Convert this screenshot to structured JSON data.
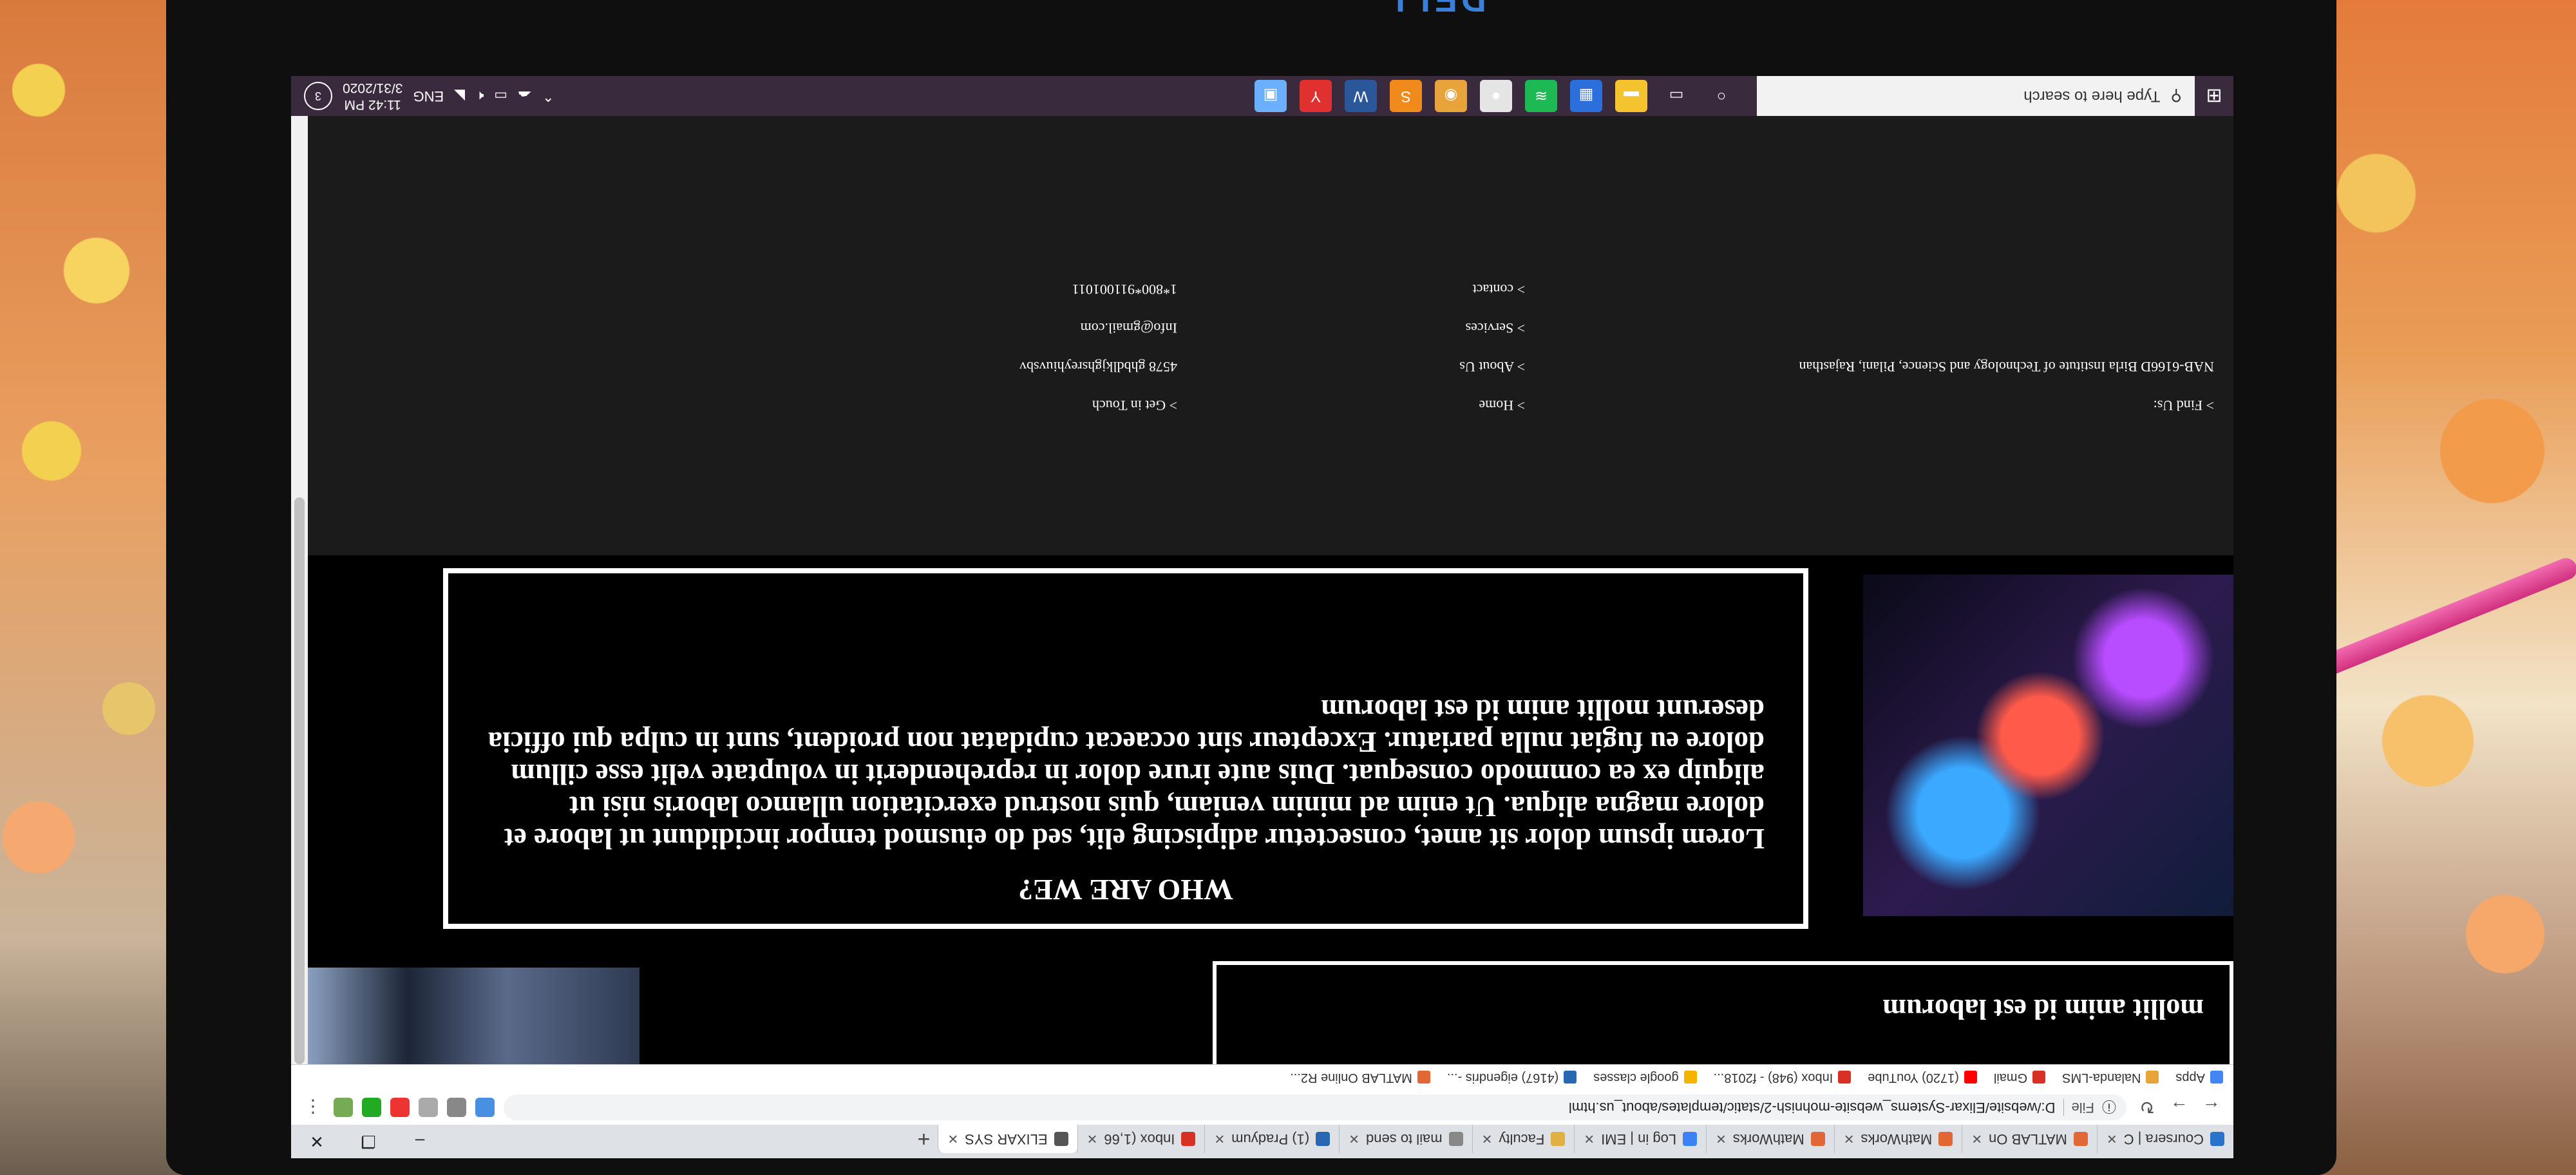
{
  "browser": {
    "tabs": [
      {
        "label": "Coursera | C",
        "color": "#2a73cc"
      },
      {
        "label": "MATLAB On",
        "color": "#e16737"
      },
      {
        "label": "MathWorks",
        "color": "#e16737"
      },
      {
        "label": "MathWorks",
        "color": "#e16737"
      },
      {
        "label": "Log in | EMI",
        "color": "#3b82f6"
      },
      {
        "label": "Faculty",
        "color": "#e0b040"
      },
      {
        "label": "mail to send",
        "color": "#888888"
      },
      {
        "label": "(1) Pradyum",
        "color": "#2867b2"
      },
      {
        "label": "Inbox (1,66",
        "color": "#d93025"
      },
      {
        "label": "ELIXAR SYS",
        "color": "#555555"
      }
    ],
    "active_tab_index": 9,
    "url_scheme": "File",
    "url": "D:/website/Elixar-Systems_website-mohnish-2/static/templates/about_us.html",
    "bookmarks": [
      {
        "label": "Apps",
        "color": "#4285f4"
      },
      {
        "label": "Nalanda-LMS",
        "color": "#e8a33a"
      },
      {
        "label": "Gmail",
        "color": "#d93025"
      },
      {
        "label": "(1720) YouTube",
        "color": "#ff0000"
      },
      {
        "label": "Inbox (948) - f2018...",
        "color": "#d93025"
      },
      {
        "label": "google classes",
        "color": "#f4b400"
      },
      {
        "label": "(4167) eigendris -...",
        "color": "#2867b2"
      },
      {
        "label": "MATLAB Online R2...",
        "color": "#e16737"
      }
    ]
  },
  "page": {
    "top_text": "mollit anim id est laborum",
    "about_title": "WHO ARE WE?",
    "about_text": "Lorem ipsum dolor sit amet, consectetur adipiscing elit, sed do eiusmod tempor incididunt ut labore et dolore magna aliqua. Ut enim ad minim veniam, quis nostrud exercitation ullamco laboris nisi ut aliquip ex ea commodo consequat. Duis aute irure dolor in reprehenderit in voluptate velit esse cillum dolore eu fugiat nulla pariatur. Excepteur sint occaecat cupidatat non proident, sunt in culpa qui officia deserunt mollit anim id est laborum",
    "footer": {
      "find_us_label": "> Find Us:",
      "address": "NAB-6166D Birla Institute of Technology and Science, Pilani, Rajasthan",
      "links": [
        "> Home",
        "> About Us",
        "> Services",
        "> contact"
      ],
      "get_in_touch_label": "> Get in Touch",
      "contact_lines": [
        "4578 ghbdlkjghsreyhiuvsbv",
        "Info@gmail.com",
        "1*800*911001011"
      ]
    }
  },
  "taskbar": {
    "search_placeholder": "Type here to search",
    "apps": [
      {
        "name": "cortana-icon",
        "color": "#3a2a3e",
        "glyph": "○"
      },
      {
        "name": "task-view-icon",
        "color": "#3a2a3e",
        "glyph": "▭"
      },
      {
        "name": "file-explorer-icon",
        "color": "#f4c430",
        "glyph": "▬"
      },
      {
        "name": "store-icon",
        "color": "#2a6fdb",
        "glyph": "▦"
      },
      {
        "name": "spotify-icon",
        "color": "#1db954",
        "glyph": "≋"
      },
      {
        "name": "app-icon",
        "color": "#e5e5e5",
        "glyph": "●"
      },
      {
        "name": "chrome-icon",
        "color": "#e8a33a",
        "glyph": "◉"
      },
      {
        "name": "sublime-icon",
        "color": "#f08a1c",
        "glyph": "S"
      },
      {
        "name": "word-icon",
        "color": "#2b579a",
        "glyph": "W"
      },
      {
        "name": "yandex-icon",
        "color": "#e03030",
        "glyph": "Y"
      },
      {
        "name": "app-icon-2",
        "color": "#6ab0ff",
        "glyph": "▣"
      }
    ],
    "language": "ENG",
    "time": "11:42 PM",
    "date": "3/31/2020",
    "notification_count": "3"
  }
}
